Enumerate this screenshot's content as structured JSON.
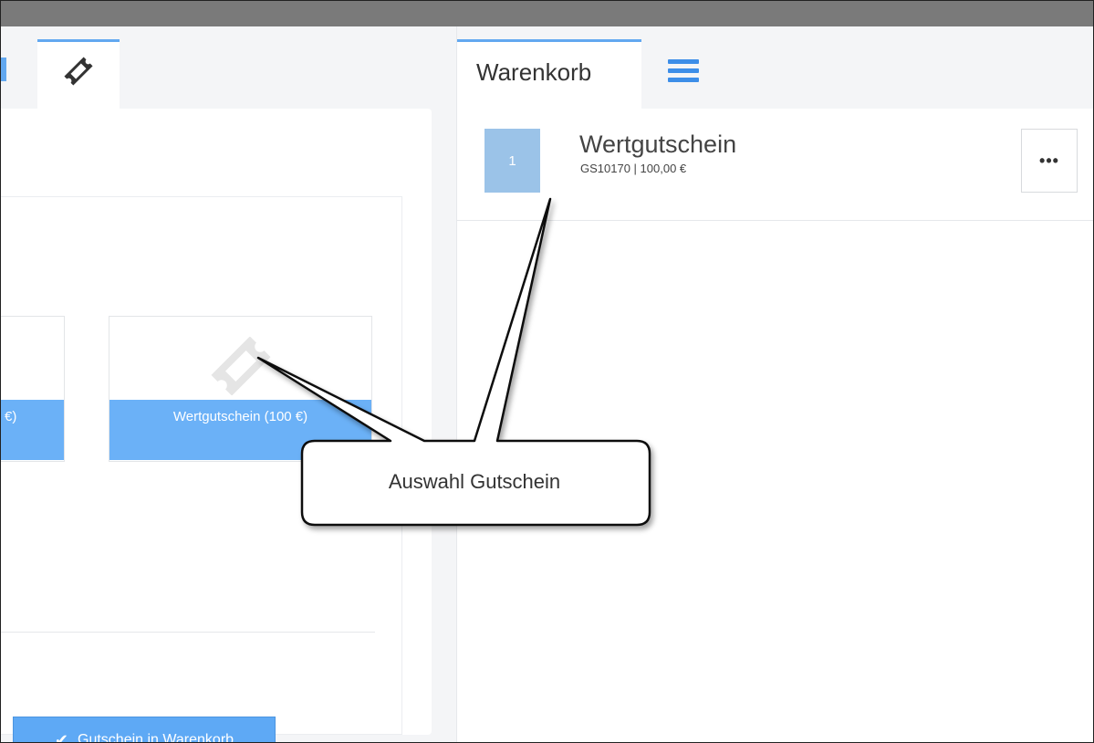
{
  "left_panel": {
    "tab_icon": "ticket-icon",
    "tiles": [
      {
        "label": "€)",
        "icon": "ticket-icon"
      },
      {
        "label": "Wertgutschein (100 €)",
        "icon": "ticket-icon"
      }
    ],
    "add_button": {
      "label": "Gutschein in Warenkorb",
      "icon": "check-icon"
    }
  },
  "cart": {
    "tab_label": "Warenkorb",
    "menu_icon": "menu-icon",
    "items": [
      {
        "quantity": "1",
        "name": "Wertgutschein",
        "meta": "GS10170 | 100,00 €",
        "more_label": "•••"
      }
    ]
  },
  "callout": {
    "text": "Auswahl Gutschein"
  },
  "colors": {
    "accent": "#62a8f0",
    "tile_label": "#6bb1f7",
    "button": "#5ea9f5",
    "qty_box": "#9bc3e8",
    "top_bar": "#7a7a7a"
  }
}
